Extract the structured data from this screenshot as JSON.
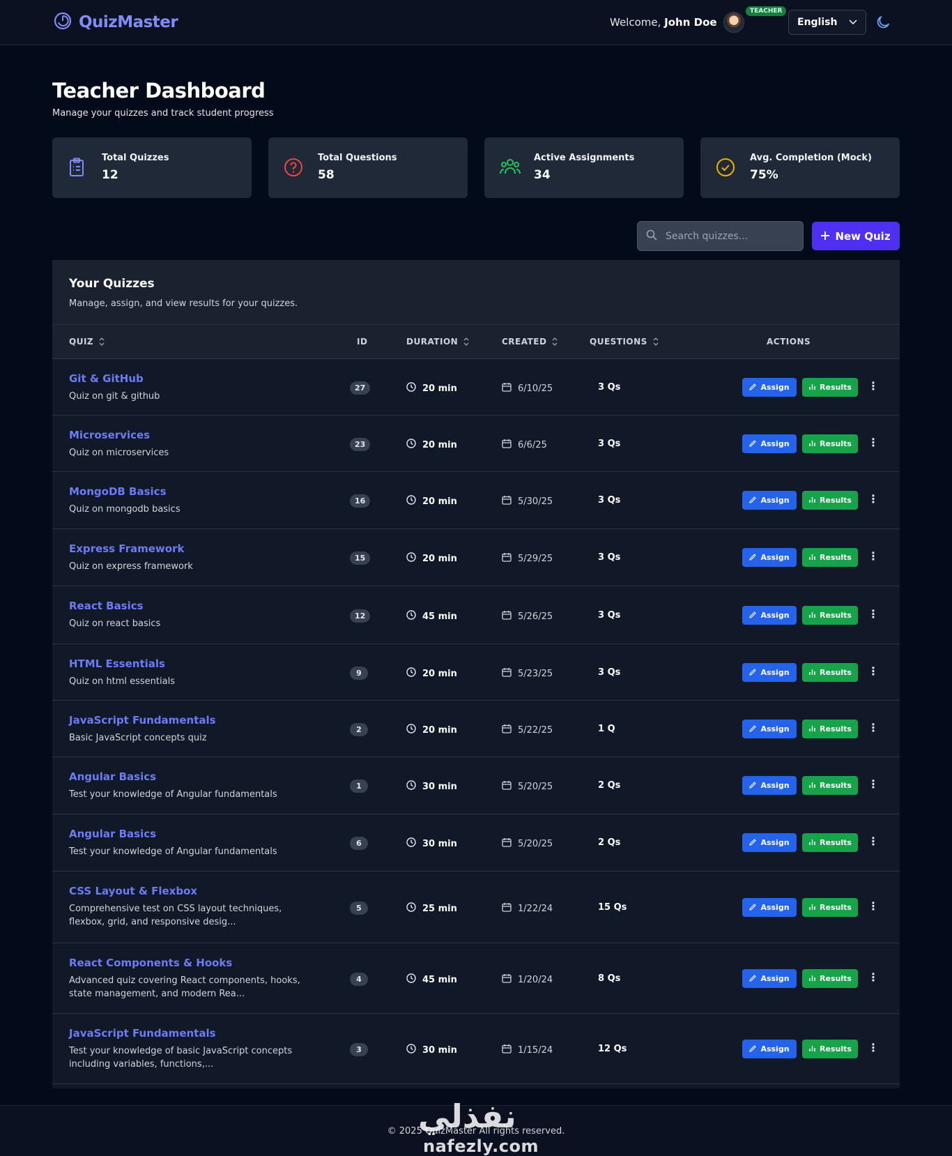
{
  "header": {
    "brand": "QuizMaster",
    "welcome_prefix": "Welcome,",
    "user_name": "John Doe",
    "role": "TEACHER",
    "language": "English",
    "icons": {
      "logo": "quiz-logo-icon",
      "theme": "moon-icon",
      "dropdown": "chevron-down-icon"
    }
  },
  "page": {
    "title": "Teacher Dashboard",
    "subtitle": "Manage your quizzes and track student progress"
  },
  "stats": [
    {
      "label": "Total Quizzes",
      "value": "12",
      "icon": "clipboard-icon",
      "color": "#818cf8"
    },
    {
      "label": "Total Questions",
      "value": "58",
      "icon": "question-circle-icon",
      "color": "#ef4444"
    },
    {
      "label": "Active Assignments",
      "value": "34",
      "icon": "users-icon",
      "color": "#22c55e"
    },
    {
      "label": "Avg. Completion (Mock)",
      "value": "75%",
      "icon": "check-circle-icon",
      "color": "#eab308"
    }
  ],
  "toolbar": {
    "search_placeholder": "Search quizzes...",
    "new_quiz_label": "New Quiz"
  },
  "panel": {
    "title": "Your Quizzes",
    "subtitle": "Manage, assign, and view results for your quizzes."
  },
  "table": {
    "columns": {
      "quiz": "QUIZ",
      "id": "ID",
      "duration": "DURATION",
      "created": "CREATED",
      "questions": "QUESTIONS",
      "actions": "ACTIONS"
    },
    "assign_label": "Assign",
    "results_label": "Results",
    "rows": [
      {
        "title": "Git & GitHub",
        "desc": "Quiz on git & github",
        "id": "27",
        "duration": "20 min",
        "created": "6/10/25",
        "questions": "3 Qs"
      },
      {
        "title": "Microservices",
        "desc": "Quiz on microservices",
        "id": "23",
        "duration": "20 min",
        "created": "6/6/25",
        "questions": "3 Qs"
      },
      {
        "title": "MongoDB Basics",
        "desc": "Quiz on mongodb basics",
        "id": "16",
        "duration": "20 min",
        "created": "5/30/25",
        "questions": "3 Qs"
      },
      {
        "title": "Express Framework",
        "desc": "Quiz on express framework",
        "id": "15",
        "duration": "20 min",
        "created": "5/29/25",
        "questions": "3 Qs"
      },
      {
        "title": "React Basics",
        "desc": "Quiz on react basics",
        "id": "12",
        "duration": "45 min",
        "created": "5/26/25",
        "questions": "3 Qs"
      },
      {
        "title": "HTML Essentials",
        "desc": "Quiz on html essentials",
        "id": "9",
        "duration": "20 min",
        "created": "5/23/25",
        "questions": "3 Qs"
      },
      {
        "title": "JavaScript Fundamentals",
        "desc": "Basic JavaScript concepts quiz",
        "id": "2",
        "duration": "20 min",
        "created": "5/22/25",
        "questions": "1 Q"
      },
      {
        "title": "Angular Basics",
        "desc": "Test your knowledge of Angular fundamentals",
        "id": "1",
        "duration": "30 min",
        "created": "5/20/25",
        "questions": "2 Qs"
      },
      {
        "title": "Angular Basics",
        "desc": "Test your knowledge of Angular fundamentals",
        "id": "6",
        "duration": "30 min",
        "created": "5/20/25",
        "questions": "2 Qs"
      },
      {
        "title": "CSS Layout & Flexbox",
        "desc": "Comprehensive test on CSS layout techniques, flexbox, grid, and responsive desig...",
        "id": "5",
        "duration": "25 min",
        "created": "1/22/24",
        "questions": "15 Qs"
      },
      {
        "title": "React Components & Hooks",
        "desc": "Advanced quiz covering React components, hooks, state management, and modern Rea...",
        "id": "4",
        "duration": "45 min",
        "created": "1/20/24",
        "questions": "8 Qs"
      },
      {
        "title": "JavaScript Fundamentals",
        "desc": "Test your knowledge of basic JavaScript concepts including variables, functions,...",
        "id": "3",
        "duration": "30 min",
        "created": "1/15/24",
        "questions": "12 Qs"
      }
    ]
  },
  "footer": {
    "copyright": "© 2025 QuizMaster All rights reserved.",
    "watermark_ar": "نفذلي",
    "watermark_en": "nafezly.com"
  }
}
